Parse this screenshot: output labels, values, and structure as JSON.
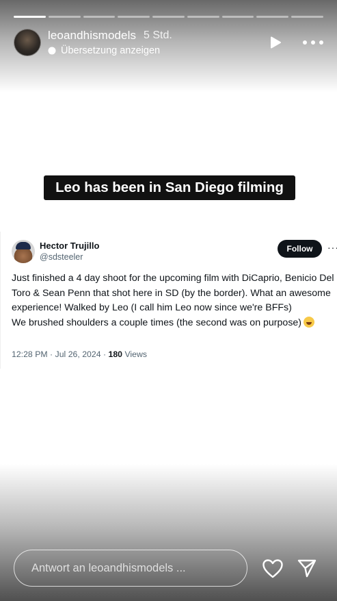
{
  "story": {
    "segments": 9,
    "active_segment": 1,
    "username": "leoandhismodels",
    "time": "5 Std.",
    "translate_label": "Übersetzung anzeigen",
    "icons": {
      "play": "play-icon",
      "more": "more-icon",
      "translate": "translate-icon",
      "heart": "heart-icon",
      "send": "send-icon"
    }
  },
  "caption": "Leo has been in San Diego filming",
  "tweet": {
    "name": "Hector Trujillo",
    "handle": "@sdsteeler",
    "follow_label": "Follow",
    "more_label": "···",
    "line1": "Just finished a 4 day shoot for the upcoming film with DiCaprio, Benicio Del Toro & Sean Penn that shot here in SD (by the border). What an awesome experience! Walked by Leo (I call him Leo now since we're BFFs)",
    "line2": "We brushed shoulders a couple times (the second was on purpose)",
    "emoji": "grinning-squinting-face-emoji",
    "timestamp": "12:28 PM · Jul 26, 2024 · ",
    "views_count": "180",
    "views_label": " Views"
  },
  "reply": {
    "placeholder": "Antwort an leoandhismodels ..."
  }
}
